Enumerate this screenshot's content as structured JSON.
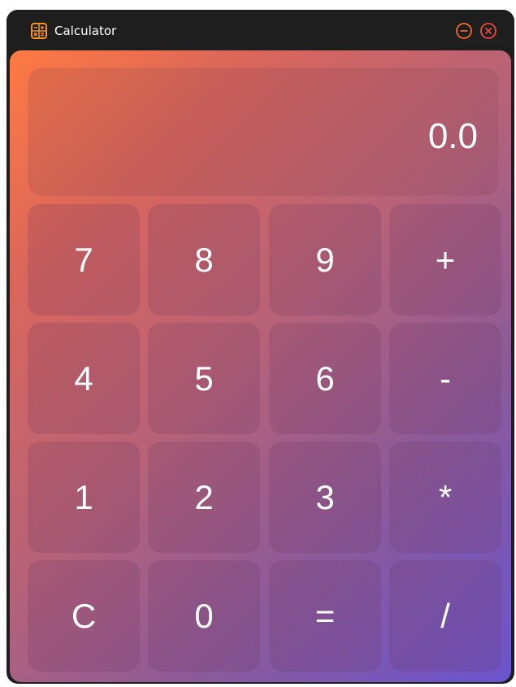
{
  "window": {
    "title": "Calculator"
  },
  "display": {
    "value": "0.0"
  },
  "keys": {
    "seven": "7",
    "eight": "8",
    "nine": "9",
    "plus": "+",
    "four": "4",
    "five": "5",
    "six": "6",
    "minus": "-",
    "one": "1",
    "two": "2",
    "three": "3",
    "multiply": "*",
    "clear": "C",
    "zero": "0",
    "equals": "=",
    "divide": "/"
  },
  "icons": {
    "app": "calculator-icon",
    "minimize": "minimize-icon",
    "close": "close-icon"
  },
  "colors": {
    "titlebar": "#1e1e1e",
    "gradient_start": "#ff7a43",
    "gradient_end": "#6a55cf",
    "window_controls": "#f26b2d",
    "text": "#ffffff"
  }
}
